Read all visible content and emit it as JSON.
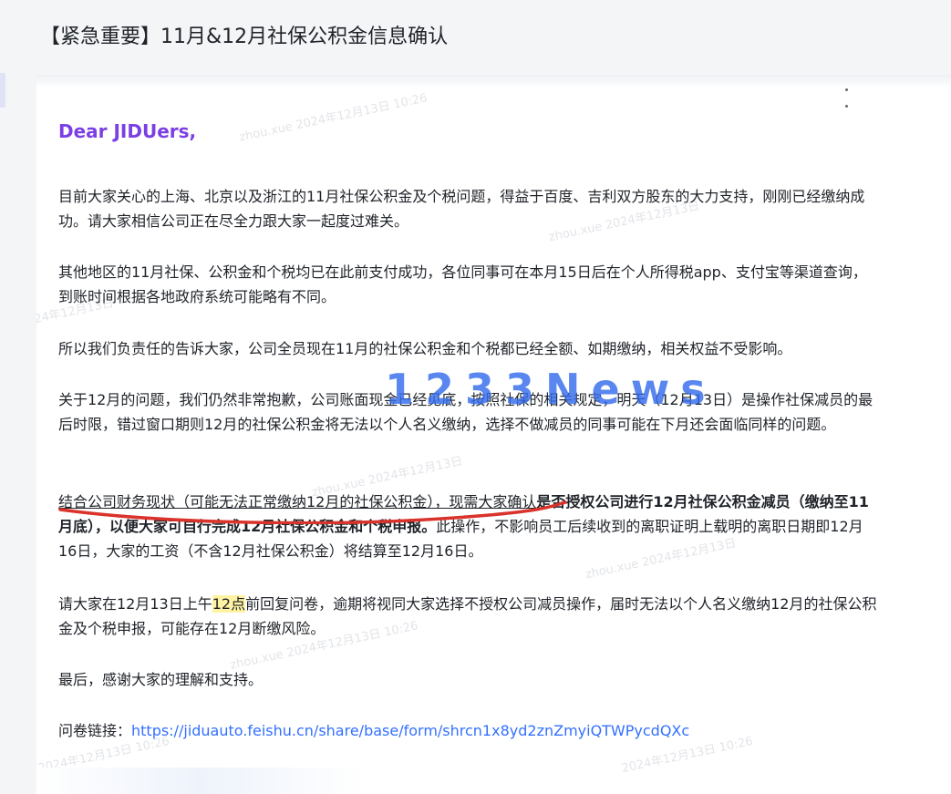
{
  "email": {
    "title": "【紧急重要】11月&12月社保公积金信息确认",
    "greeting": "Dear JIDUers,",
    "paragraphs": {
      "p1": "目前大家关心的上海、北京以及浙江的11月社保公积金及个税问题，得益于百度、吉利双方股东的大力支持，刚刚已经缴纳成功。请大家相信公司正在尽全力跟大家一起度过难关。",
      "p2": "其他地区的11月社保、公积金和个税均已在此前支付成功，各位同事可在本月15日后在个人所得税app、支付宝等渠道查询，到账时间根据各地政府系统可能略有不同。",
      "p3": "所以我们负责任的告诉大家，公司全员现在11月的社保公积金和个税都已经全额、如期缴纳，相关权益不受影响。",
      "p4": "关于12月的问题，我们仍然非常抱歉，公司账面现金已经见底，按照社保的相关规定，明天（12月13日）是操作社保减员的最后时限，错过窗口期则12月的社保公积金将无法以个人名义缴纳，选择不做减员的同事可能在下月还会面临同样的问题。",
      "p5_underlined": "结合公司财务现状（可能无法正常缴纳12月的社保公积金），现需大家确认",
      "p5_bold": "是否授权公司进行12月社保公积金减员（缴纳至11月底），以便大家可自行完成12月社保公积金和个税申报。",
      "p5_rest": "此操作，不影响员工后续收到的离职证明上载明的离职日期即12月16日，大家的工资（不含12月社保公积金）将结算至12月16日。",
      "p6_before": "请大家在12月13日上午",
      "p6_highlight": "12点",
      "p6_after": "前回复问卷，逾期将视同大家选择不授权公司减员操作，届时无法以个人名义缴纳12月的社保公积金及个税申报，可能存在12月断缴风险。",
      "p7": "最后，感谢大家的理解和支持。",
      "p8_label": "问卷链接：",
      "p8_link": "https://jiduauto.feishu.cn/share/base/form/shrcn1x8yd2znZmyiQTWPycdQXc"
    }
  },
  "overlay": {
    "brand_watermark": "1233News",
    "accent_color": "#7b3fe4",
    "link_color": "#3370ff",
    "highlight_color": "#fff3a3",
    "annotation_color": "#d9332b"
  },
  "icons": {
    "more": "more-vertical-icon"
  }
}
